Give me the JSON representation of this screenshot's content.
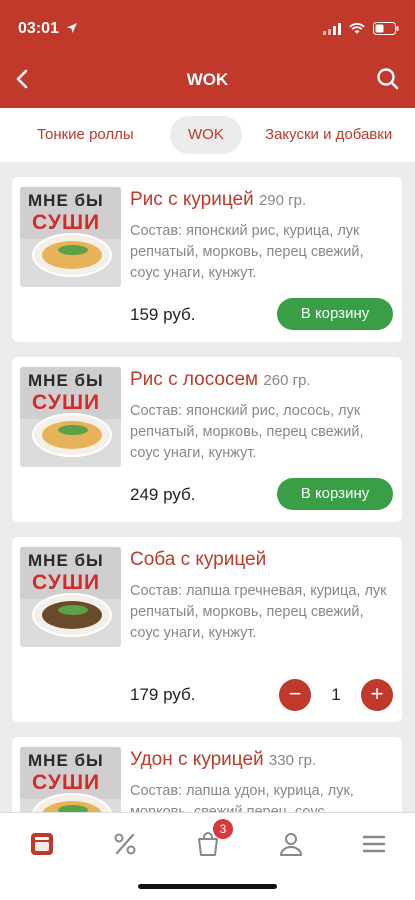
{
  "status_bar": {
    "time": "03:01"
  },
  "header": {
    "title": "WOK"
  },
  "tabs": [
    {
      "label": "Тонкие роллы"
    },
    {
      "label": "WOK"
    },
    {
      "label": "Закуски и добавки"
    }
  ],
  "products": [
    {
      "name": "Рис с курицей",
      "weight": "290 гр.",
      "description": "Состав: японский рис, курица, лук репчатый, морковь, перец свежий, соус унаги, кунжут.",
      "price": "159 руб.",
      "cart_label": "В корзину",
      "logo_text_1": "МНЕ бЫ",
      "logo_text_2": "СУШИ"
    },
    {
      "name": "Рис с лососем",
      "weight": "260 гр.",
      "description": "Состав: японский рис, лосось, лук репчатый, морковь, перец свежий, соус унаги, кунжут.",
      "price": "249 руб.",
      "cart_label": "В корзину",
      "logo_text_1": "МНЕ бЫ",
      "logo_text_2": "СУШИ"
    },
    {
      "name": "Соба с курицей",
      "weight": "",
      "description": "Состав: лапша гречневая, курица, лук репчатый, морковь, перец свежий, соус унаги, кунжут.",
      "price": "179 руб.",
      "quantity": "1",
      "minus": "−",
      "plus": "+",
      "logo_text_1": "МНЕ бЫ",
      "logo_text_2": "СУШИ"
    },
    {
      "name": "Удон с курицей",
      "weight": "330 гр.",
      "description": "Состав: лапша удон, курица, лук, морковь, свежий перец, соус",
      "logo_text_1": "МНЕ бЫ",
      "logo_text_2": "СУШИ"
    }
  ],
  "tab_bar": {
    "cart_badge": "3"
  },
  "colors": {
    "brand": "#c0392b",
    "cart_button": "#3a9e47",
    "badge": "#d9383a"
  }
}
